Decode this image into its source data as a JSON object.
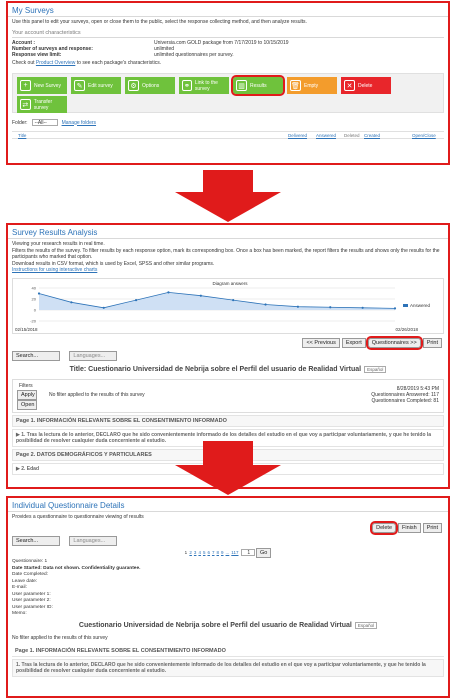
{
  "panel1": {
    "title": "My Surveys",
    "intro": "Use this panel to edit your surveys, open or close them to the public, select the response collecting method, and then analyze results.",
    "section": "Your account characteristics",
    "account_rows": [
      {
        "key": "Account :",
        "value": "Universia.com GOLD package from 7/17/2019 to 10/15/2019"
      },
      {
        "key": "Number of surveys and response:",
        "value": "unlimited"
      },
      {
        "key": "Response view limit:",
        "value": "unlimited questionnaires per survey."
      }
    ],
    "check_prefix": "Check out ",
    "check_link": "Product Overview",
    "check_suffix": " to see each package's characteristics.",
    "toolbar": {
      "new_survey": "New Survey",
      "edit_survey": "Edit survey",
      "options": "Options",
      "link_to_survey": "Link to the survey",
      "results": "Results",
      "empty": "Empty",
      "delete": "Delete",
      "transfer_survey": "Transfer survey"
    },
    "folder_label": "Folder:",
    "folder_value": "--All--",
    "manage_folders": "Manage folders",
    "cols": {
      "title": "Title",
      "delivered": "Delivered",
      "answered": "Answered",
      "deleted": "Deleted",
      "created": "Created",
      "open_close": "Open/Close"
    }
  },
  "panel2": {
    "title": "Survey Results Analysis",
    "line1": "Viewing your research results in real time.",
    "line2": "Filters the results of the survey. To filter results by each response option, mark its corresponding box. Once a box has been marked, the report filters the results and shows only the results for the participants who marked that option.",
    "line3": "Download results in CSV format, which is used by Excel, SPSS and other similar programs.",
    "instructions_link": "Instructions for using interactive charts",
    "chart_title": "Diagram answers",
    "legend": "Answered",
    "date_start": "02/15/2018",
    "date_end": "02/26/2018",
    "btn_previous": "<< Previous",
    "btn_export": "Export",
    "btn_questionnaires": "Questionnaires >>",
    "btn_print": "Print",
    "btn_search": "Search...",
    "btn_languages": "Languages...",
    "survey_title": "Title: Cuestionario Universidad de Nebrija sobre el Perfil del usuario de Realidad Virtual",
    "lang_select": "Español",
    "filters_label": "Filters",
    "btn_apply": "Apply",
    "btn_open": "Open",
    "no_filter": "No filter applied to the results of this survey",
    "date_time": "8/28/2019 5:43 PM",
    "q_answered": "Questionnaires Answered: 117",
    "q_completed": "Questionnaires Completed: 81",
    "page1": "Page 1. INFORMACIÓN RELEVANTE SOBRE EL CONSENTIMIENTO INFORMADO",
    "q1": "▶ 1. Tras la lectura de lo anterior, DECLARO que he sido convenientemente informado de los detalles del estudio en el que voy a participar voluntariamente, y que he tenido la posibilidad de resolver cualquier duda concerniente al estudio.",
    "page2": "Page 2. DATOS DEMOGRÁFICOS Y PARTICULARES",
    "q2": "▶ 2. Edad"
  },
  "panel3": {
    "title": "Individual Questionnaire Details",
    "intro": "Provides a questionnaire to questionnaire viewing of results",
    "btn_delete": "Delete",
    "btn_finish": "Finish",
    "btn_print": "Print",
    "btn_search": "Search...",
    "btn_languages": "Languages...",
    "pager_prefix": "1",
    "pager_links": [
      "2",
      "3",
      "4",
      "5",
      "6",
      "7",
      "8",
      "9",
      "...",
      "117"
    ],
    "pager_input": "1",
    "btn_go": "Go",
    "meta": [
      "Questionnaire: 1",
      "Date Started: Data not shown. Confidentiality guarantee.",
      "Date Completed:",
      "Leave date:",
      "E-mail:",
      "User parameter 1:",
      "User parameter 2:",
      "User parameter ID:",
      "Memo:"
    ],
    "survey_title": "Cuestionario Universidad de Nebrija sobre el Perfil del usuario de Realidad Virtual",
    "lang_select": "Español",
    "no_filter": "No filter applied to the results of this survey",
    "page1": "Page 1. INFORMACIÓN RELEVANTE SOBRE EL CONSENTIMIENTO INFORMADO",
    "q1": "1. Tras la lectura de lo anterior, DECLARO que he sido convenientemente informado de los detalles del estudio en el que voy a participar voluntariamente, y que he tenido la posibilidad de resolver cualquier duda concerniente al estudio."
  },
  "colors": {
    "highlight": "#e01b1b",
    "link": "#2d73b8",
    "green": "#6fc23c",
    "orange": "#f39c2c",
    "red": "#e8262b"
  },
  "chart_data": {
    "type": "area",
    "title": "Diagram answers",
    "x": [
      "02/15/2018",
      "02/16/2018",
      "02/17/2018",
      "02/18/2018",
      "02/19/2018",
      "02/20/2018",
      "02/21/2018",
      "02/22/2018",
      "02/23/2018",
      "02/24/2018",
      "02/25/2018",
      "02/26/2018"
    ],
    "series": [
      {
        "name": "Answered",
        "values": [
          30,
          14,
          4,
          18,
          32,
          26,
          18,
          10,
          6,
          5,
          4,
          3
        ]
      }
    ],
    "y_ticks": [
      40,
      20,
      0,
      -20
    ],
    "x_tick_labels": [
      "02/15/2018",
      "02/26/2018"
    ],
    "ylim": [
      -20,
      40
    ],
    "legend_position": "right"
  }
}
